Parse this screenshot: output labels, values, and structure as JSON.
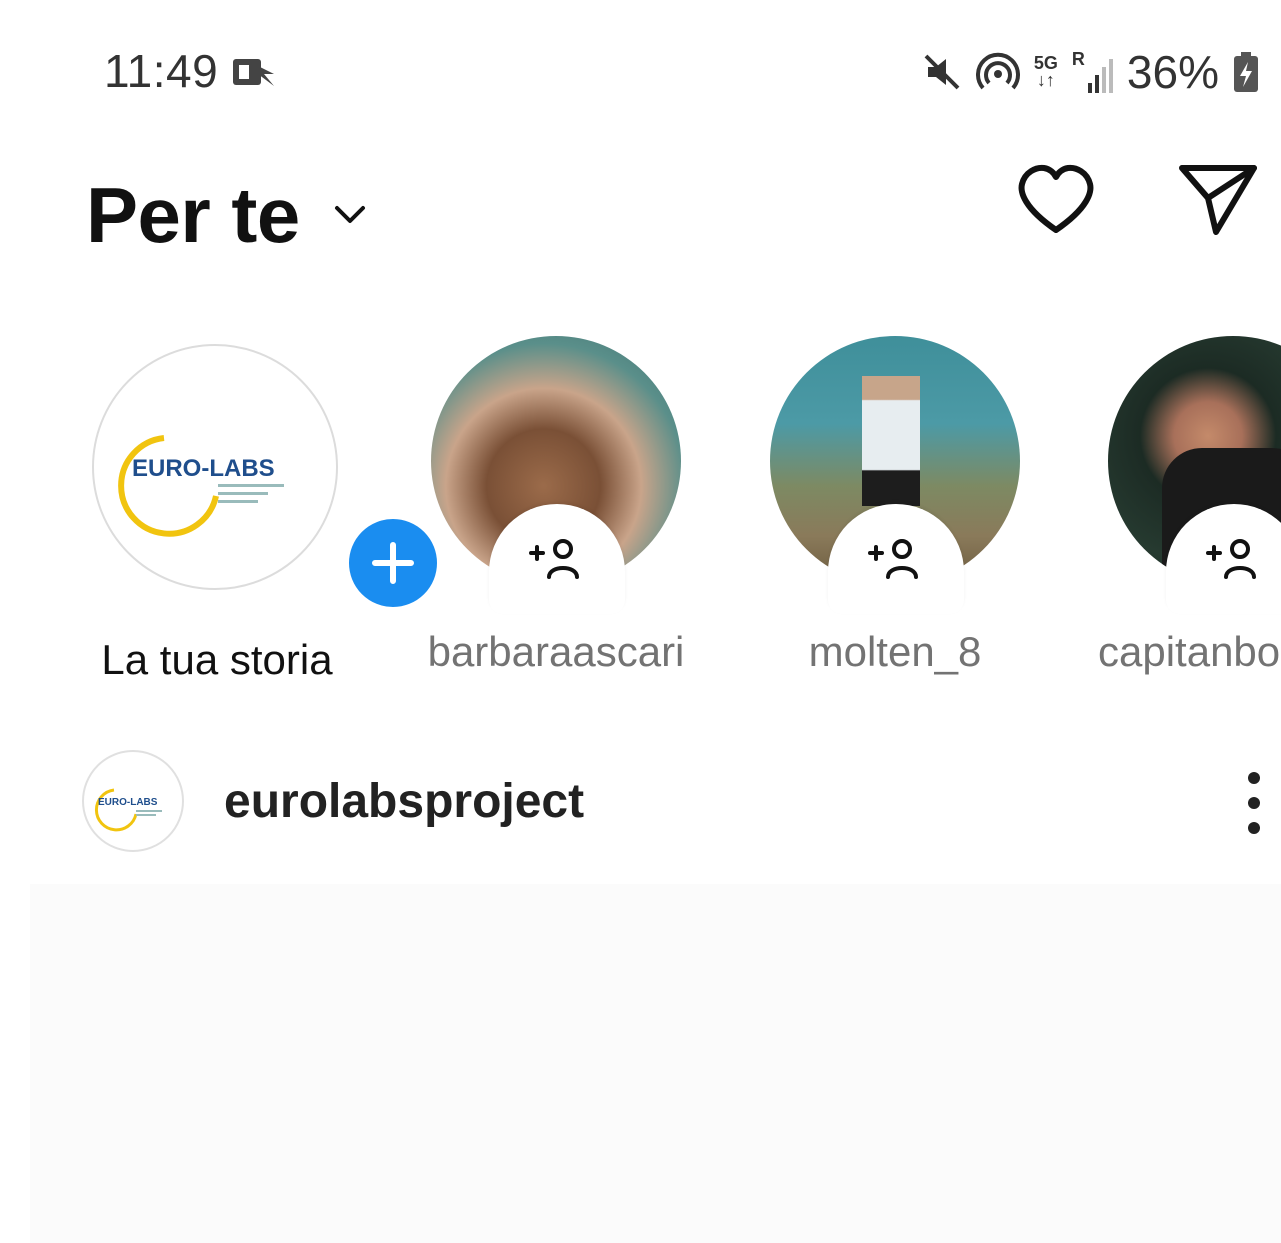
{
  "status_bar": {
    "time": "11:49",
    "network": "5G",
    "roaming": "R",
    "battery": "36%"
  },
  "header": {
    "title": "Per te"
  },
  "stories": [
    {
      "username": "La tua storia",
      "logo_text": "EURO-LABS"
    },
    {
      "username": "barbaraascari"
    },
    {
      "username": "molten_8"
    },
    {
      "username": "capitanbo"
    }
  ],
  "post": {
    "username": "eurolabsproject",
    "logo_text": "EURO-LABS"
  },
  "colors": {
    "accent": "#1a8df0",
    "text_primary": "#111111",
    "text_secondary": "#737373",
    "background": "#ffffff"
  }
}
